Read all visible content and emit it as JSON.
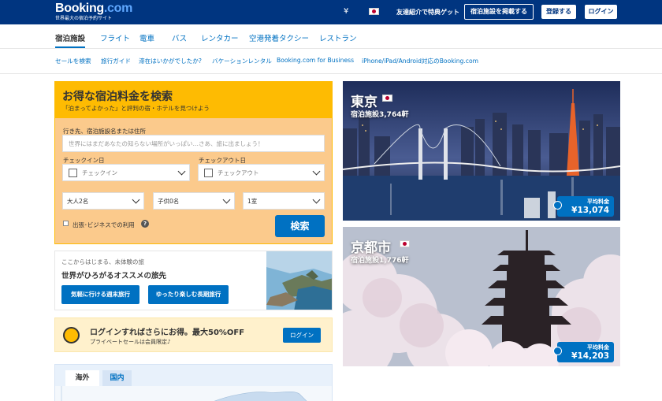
{
  "header": {
    "logo_main": "Booking",
    "logo_com": ".com",
    "tagline": "世界最大の宿泊予約サイト",
    "currency": "¥",
    "referral": "友達紹介で特典ゲット",
    "list_property": "宿泊施設を掲載する",
    "register": "登録する",
    "login": "ログイン"
  },
  "nav": {
    "items": [
      "宿泊施設",
      "フライト",
      "電車",
      "バス",
      "レンタカー",
      "空港発着タクシー",
      "レストラン"
    ]
  },
  "subnav": {
    "items": [
      "セールを検索",
      "旅行ガイド",
      "滞在はいかがでしたか?",
      "バケーションレンタル",
      "Booking.com for Business",
      "iPhone/iPad/Android対応のBooking.com"
    ]
  },
  "search": {
    "title": "お得な宿泊料金を検索",
    "subtitle": "「泊まってよかった」と評判の宿・ホテルを見つけよう",
    "destination_label": "行き先、宿泊施設名または住所",
    "destination_placeholder": "世界にはまだあなたの知らない場所がいっぱい…さあ、旅に出ましょう！",
    "checkin_label": "チェックイン日",
    "checkin_value": "チェックイン",
    "checkout_label": "チェックアウト日",
    "checkout_value": "チェックアウト",
    "adults": "大人2名",
    "children": "子供0名",
    "rooms": "1室",
    "business_label": "出張･ビジネスでの利用",
    "search_button": "検索"
  },
  "promo": {
    "line1": "ここからはじまる、未体験の旅",
    "line2": "世界がひろがるオススメの旅先",
    "btn_weekend": "気軽に行ける週末旅行",
    "btn_long": "ゆったり楽しむ長期旅行"
  },
  "login_banner": {
    "text": "ログインすればさらにお得。最大50%OFF",
    "sub": "プライベートセールは会員限定♪",
    "button": "ログイン"
  },
  "map_tabs": {
    "overseas": "海外",
    "domestic": "国内"
  },
  "cities": [
    {
      "name": "東京",
      "count": "宿泊施設3,764軒",
      "price_label": "平均料金",
      "price": "¥13,074"
    },
    {
      "name": "京都市",
      "count": "宿泊施設1,776軒",
      "price_label": "平均料金",
      "price": "¥14,203"
    }
  ],
  "colors": {
    "brand": "#003580",
    "accent": "#0071c2",
    "search_box": "#febb02"
  }
}
